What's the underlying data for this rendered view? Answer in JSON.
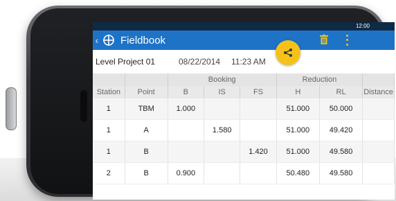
{
  "status_bar": {
    "time": "12:00"
  },
  "app_bar": {
    "title": "Fieldbook"
  },
  "project": {
    "name": "Level Project 01",
    "date": "08/22/2014",
    "time": "11:23 AM"
  },
  "table": {
    "groups": {
      "booking": "Booking",
      "reduction": "Reduction"
    },
    "columns": [
      "Station",
      "Point",
      "B",
      "IS",
      "FS",
      "H",
      "RL",
      "Distance"
    ],
    "rows": [
      [
        "1",
        "TBM",
        "1.000",
        "",
        "",
        "51.000",
        "50.000",
        ""
      ],
      [
        "1",
        "A",
        "",
        "1.580",
        "",
        "51.000",
        "49.420",
        ""
      ],
      [
        "1",
        "B",
        "",
        "",
        "1.420",
        "51.000",
        "49.580",
        ""
      ],
      [
        "2",
        "B",
        "0.900",
        "",
        "",
        "50.480",
        "49.580",
        ""
      ]
    ]
  },
  "colors": {
    "app_bar": "#1e73c7",
    "share_button": "#f6c21a",
    "status_bar": "#0f2a44"
  },
  "icons": [
    "back-arrow-icon",
    "compass-logo-icon",
    "share-icon",
    "trash-icon",
    "more-vert-icon"
  ]
}
